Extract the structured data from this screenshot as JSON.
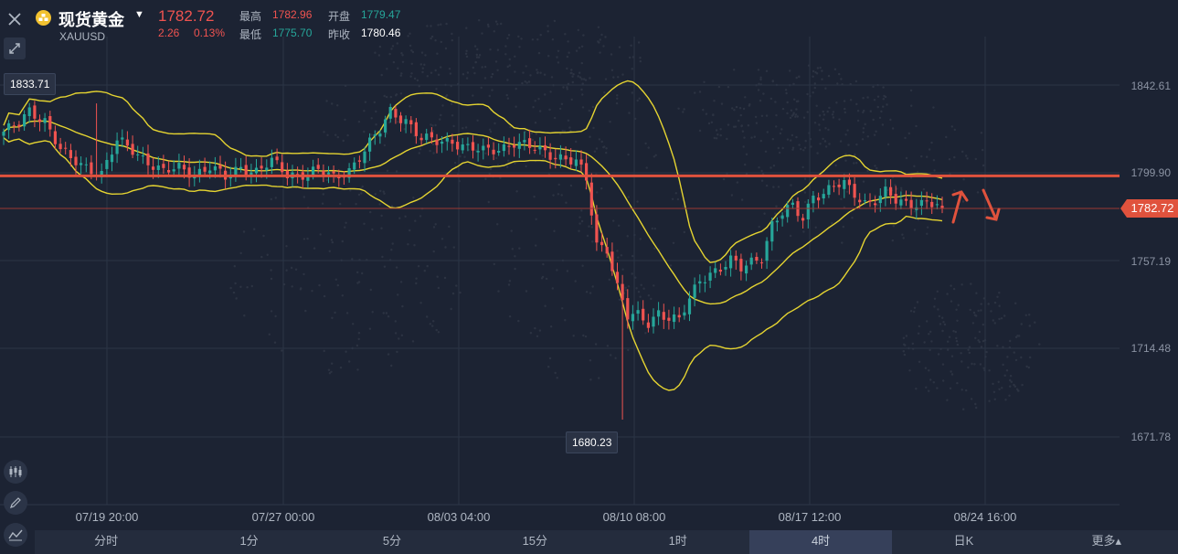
{
  "header": {
    "symbol_name": "现货黄金",
    "symbol_code": "XAUUSD",
    "last_price": "1782.72",
    "change": "2.26",
    "change_pct": "0.13%",
    "high_label": "最高",
    "high_value": "1782.96",
    "open_label": "开盘",
    "open_value": "1779.47",
    "low_label": "最低",
    "low_value": "1775.70",
    "prev_close_label": "昨收",
    "prev_close_value": "1780.46"
  },
  "icons": {
    "close": "close-icon",
    "expand": "expand-diagonal-icon",
    "coin": "gold-coin-icon",
    "caret": "caret-down-icon",
    "candle_tool": "candlestick-icon",
    "draw_tool": "pencil-icon",
    "indicator_tool": "line-indicator-icon"
  },
  "colors": {
    "background": "#1c2333",
    "up": "#26a69a",
    "down": "#ef5350",
    "band": "#e5d431",
    "support_line": "#e0523d",
    "price_tag": "#e0523d"
  },
  "yaxis": [
    "1842.61",
    "1799.90",
    "1757.19",
    "1714.48",
    "1671.78"
  ],
  "xaxis": [
    "07/19 20:00",
    "07/27 00:00",
    "08/03 04:00",
    "08/10 08:00",
    "08/17 12:00",
    "08/24 16:00"
  ],
  "current_price_tag": "1782.72",
  "callouts": {
    "high_marker": "1833.71",
    "low_marker": "1680.23"
  },
  "tabs": [
    "分时",
    "1分",
    "5分",
    "15分",
    "1时",
    "4时",
    "日K",
    "更多▴"
  ],
  "active_tab": "4时",
  "chart_data": {
    "type": "candlestick",
    "ylim": [
      1660,
      1855
    ],
    "horizontal_line": 1798.5,
    "last": 1782.72,
    "close_path": [
      [
        0,
        1820
      ],
      [
        3,
        1823
      ],
      [
        5,
        1830
      ],
      [
        8,
        1826
      ],
      [
        11,
        1811
      ],
      [
        13,
        1806
      ],
      [
        16,
        1803
      ],
      [
        19,
        1800
      ],
      [
        22,
        1815
      ],
      [
        25,
        1811
      ],
      [
        28,
        1806
      ],
      [
        31,
        1800
      ],
      [
        34,
        1802
      ],
      [
        37,
        1800
      ],
      [
        40,
        1803
      ],
      [
        43,
        1797
      ],
      [
        46,
        1803
      ],
      [
        49,
        1801
      ],
      [
        52,
        1805
      ],
      [
        55,
        1799
      ],
      [
        58,
        1800
      ],
      [
        61,
        1801
      ],
      [
        64,
        1797
      ],
      [
        67,
        1802
      ],
      [
        70,
        1811
      ],
      [
        73,
        1820
      ],
      [
        75,
        1830
      ],
      [
        78,
        1826
      ],
      [
        81,
        1816
      ],
      [
        84,
        1815
      ],
      [
        87,
        1816
      ],
      [
        90,
        1812
      ],
      [
        93,
        1810
      ],
      [
        96,
        1812
      ],
      [
        99,
        1815
      ],
      [
        102,
        1812
      ],
      [
        105,
        1810
      ],
      [
        108,
        1808
      ],
      [
        111,
        1805
      ],
      [
        113,
        1796
      ],
      [
        115,
        1765
      ],
      [
        117,
        1764
      ],
      [
        119,
        1745
      ],
      [
        121,
        1730
      ],
      [
        123,
        1730
      ],
      [
        125,
        1727
      ],
      [
        127,
        1733
      ],
      [
        129,
        1730
      ],
      [
        131,
        1728
      ],
      [
        133,
        1738
      ],
      [
        135,
        1748
      ],
      [
        137,
        1752
      ],
      [
        139,
        1754
      ],
      [
        141,
        1757
      ],
      [
        143,
        1753
      ],
      [
        145,
        1757
      ],
      [
        147,
        1760
      ],
      [
        149,
        1775
      ],
      [
        151,
        1780
      ],
      [
        153,
        1783
      ],
      [
        155,
        1778
      ],
      [
        157,
        1790
      ],
      [
        159,
        1790
      ],
      [
        161,
        1793
      ],
      [
        163,
        1794
      ],
      [
        165,
        1790
      ],
      [
        167,
        1786
      ],
      [
        169,
        1787
      ],
      [
        171,
        1790
      ],
      [
        173,
        1786
      ],
      [
        175,
        1785
      ],
      [
        177,
        1786
      ],
      [
        179,
        1786
      ],
      [
        181,
        1784
      ],
      [
        182,
        1782.72
      ]
    ]
  }
}
